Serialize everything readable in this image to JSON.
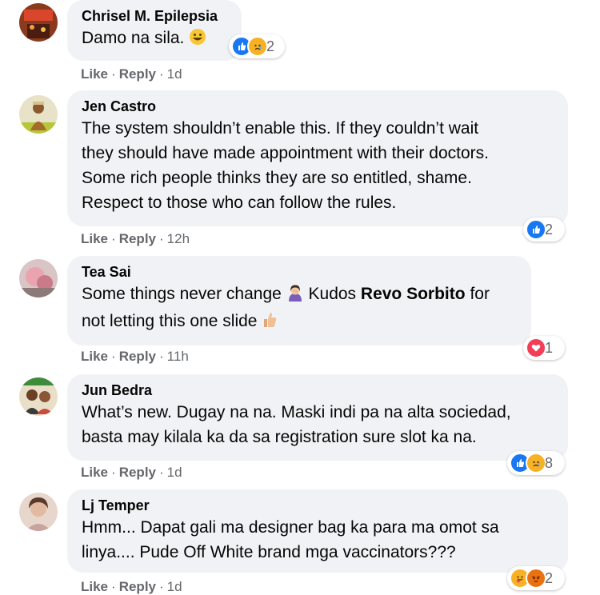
{
  "action_like": "Like",
  "action_reply": "Reply",
  "separator": "·",
  "comments": [
    {
      "author": "Chrisel M. Epilepsia",
      "text": "Damo na sila.",
      "time": "1d",
      "reaction_count": "2",
      "reactions": [
        "like-icon",
        "sad-icon"
      ]
    },
    {
      "author": "Jen Castro",
      "lines": [
        "The system shouldn’t enable this. If they couldn’t wait",
        "they should have made appointment with their doctors.",
        "Some rich people thinks they are so entitled, shame.",
        "Respect to those who can follow the rules."
      ],
      "time": "12h",
      "reaction_count": "2",
      "reactions": [
        "like-icon"
      ]
    },
    {
      "author": "Tea Sai",
      "text_a": "Some things never change",
      "text_b": "Kudos",
      "mention": "Revo Sorbito",
      "text_c": "for",
      "text_d": "not letting this one slide",
      "time": "11h",
      "reaction_count": "1",
      "reactions": [
        "love-icon"
      ]
    },
    {
      "author": "Jun Bedra",
      "lines": [
        "What’s new. Dugay na na. Maski indi pa na alta sociedad,",
        "basta may kilala ka da sa registration sure slot ka na."
      ],
      "time": "1d",
      "reaction_count": "8",
      "reactions": [
        "like-icon",
        "sad-icon"
      ]
    },
    {
      "author": "Lj Temper",
      "lines": [
        "Hmm... Dapat gali ma designer bag ka para ma omot sa",
        "linya.... Pude Off White brand mga vaccinators???"
      ],
      "time": "1d",
      "reaction_count": "2",
      "reactions": [
        "care-icon",
        "angry-icon"
      ]
    }
  ]
}
